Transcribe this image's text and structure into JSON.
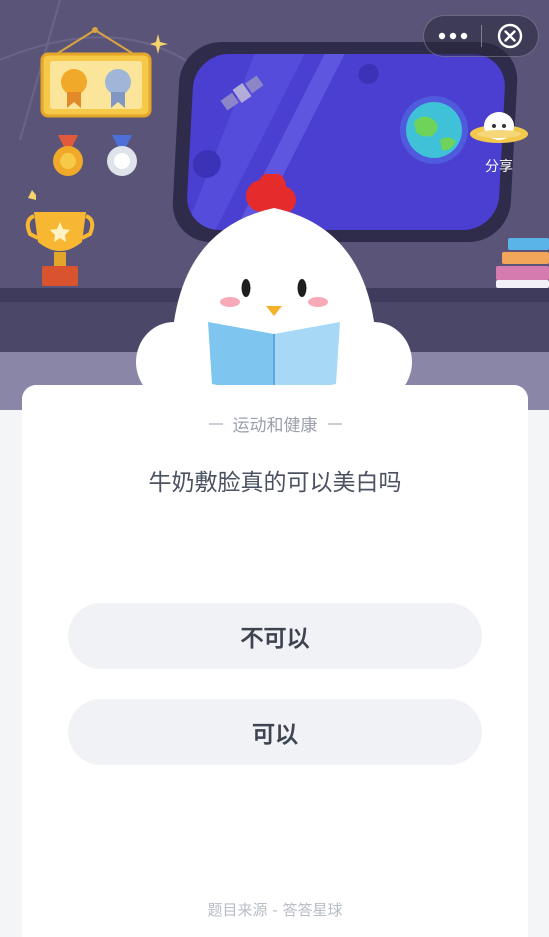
{
  "header": {
    "share_label": "分享",
    "icons": [
      "more-icon",
      "close-icon",
      "satellite-icon",
      "planet-icon",
      "ufo-icon",
      "trophy-icon",
      "medal-icon",
      "book-icon"
    ]
  },
  "card": {
    "category": "运动和健康",
    "question": "牛奶敷脸真的可以美白吗",
    "options": [
      {
        "label": "不可以"
      },
      {
        "label": "可以"
      }
    ],
    "source": "题目来源 - 答答星球"
  },
  "colors": {
    "scene_bg": "#5a5578",
    "window_glass": "#4a3fd1",
    "card_bg": "#ffffff",
    "option_bg": "#f1f2f5",
    "text_primary": "#4a5160",
    "text_muted": "#9aa0ab"
  }
}
